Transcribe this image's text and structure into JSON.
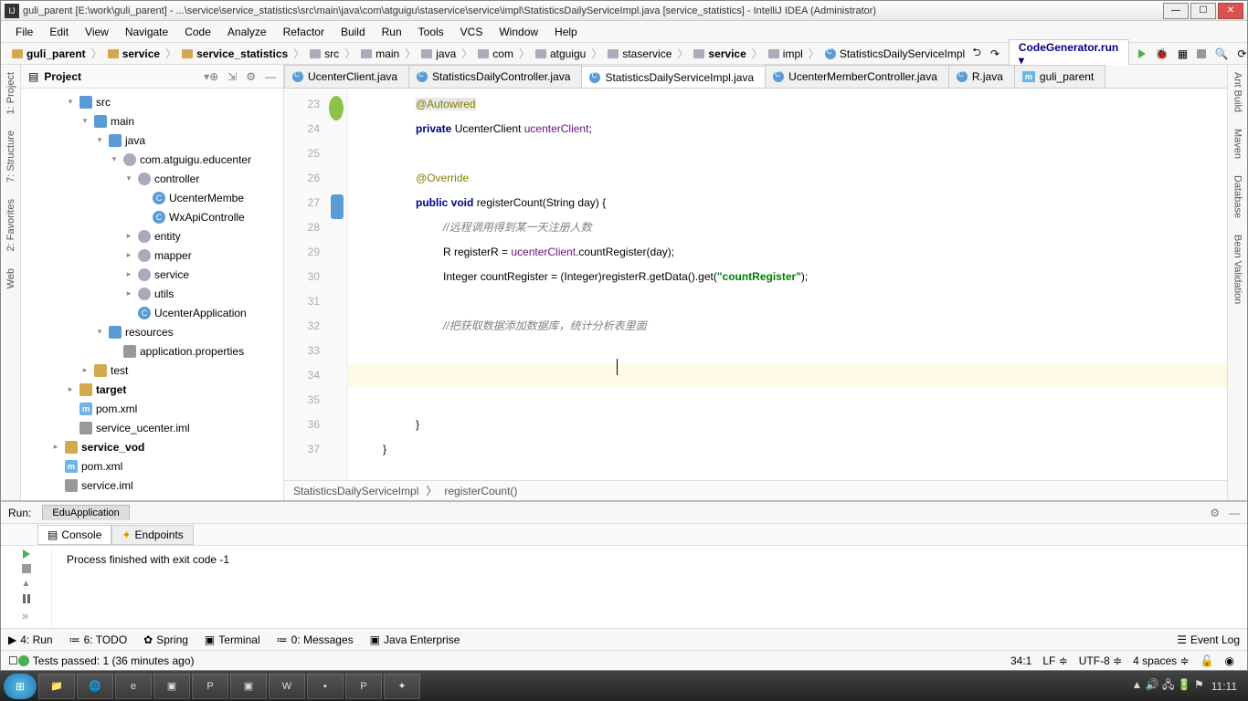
{
  "window": {
    "title": "guli_parent [E:\\work\\guli_parent] - ...\\service\\service_statistics\\src\\main\\java\\com\\atguigu\\staservice\\service\\impl\\StatisticsDailyServiceImpl.java [service_statistics] - IntelliJ IDEA (Administrator)"
  },
  "menu": [
    "File",
    "Edit",
    "View",
    "Navigate",
    "Code",
    "Analyze",
    "Refactor",
    "Build",
    "Run",
    "Tools",
    "VCS",
    "Window",
    "Help"
  ],
  "breadcrumbs": [
    "guli_parent",
    "service",
    "service_statistics",
    "src",
    "main",
    "java",
    "com",
    "atguigu",
    "staservice",
    "service",
    "impl",
    "StatisticsDailyServiceImpl"
  ],
  "run_config": "CodeGenerator.run",
  "project": {
    "title": "Project"
  },
  "tree": [
    {
      "d": 3,
      "a": "▾",
      "i": "src",
      "t": "src"
    },
    {
      "d": 4,
      "a": "▾",
      "i": "src",
      "t": "main"
    },
    {
      "d": 5,
      "a": "▾",
      "i": "src",
      "t": "java"
    },
    {
      "d": 6,
      "a": "▾",
      "i": "pkg",
      "t": "com.atguigu.educenter"
    },
    {
      "d": 7,
      "a": "▾",
      "i": "pkg",
      "t": "controller"
    },
    {
      "d": 8,
      "a": "",
      "i": "class",
      "t": "UcenterMembe"
    },
    {
      "d": 8,
      "a": "",
      "i": "class",
      "t": "WxApiControlle"
    },
    {
      "d": 7,
      "a": "▸",
      "i": "pkg",
      "t": "entity"
    },
    {
      "d": 7,
      "a": "▸",
      "i": "pkg",
      "t": "mapper"
    },
    {
      "d": 7,
      "a": "▸",
      "i": "pkg",
      "t": "service"
    },
    {
      "d": 7,
      "a": "▸",
      "i": "pkg",
      "t": "utils"
    },
    {
      "d": 7,
      "a": "",
      "i": "class",
      "t": "UcenterApplication"
    },
    {
      "d": 5,
      "a": "▾",
      "i": "src",
      "t": "resources"
    },
    {
      "d": 6,
      "a": "",
      "i": "file",
      "t": "application.properties"
    },
    {
      "d": 4,
      "a": "▸",
      "i": "folder",
      "t": "test"
    },
    {
      "d": 3,
      "a": "▸",
      "i": "folder-o",
      "t": "target",
      "b": true
    },
    {
      "d": 3,
      "a": "",
      "i": "m",
      "t": "pom.xml"
    },
    {
      "d": 3,
      "a": "",
      "i": "file",
      "t": "service_ucenter.iml"
    },
    {
      "d": 2,
      "a": "▸",
      "i": "folder",
      "t": "service_vod",
      "b": true
    },
    {
      "d": 2,
      "a": "",
      "i": "m",
      "t": "pom.xml"
    },
    {
      "d": 2,
      "a": "",
      "i": "file",
      "t": "service.iml"
    }
  ],
  "left_tabs": [
    "1: Project",
    "7: Structure",
    "2: Favorites",
    "Web"
  ],
  "right_tabs": [
    "Ant Build",
    "Maven",
    "Database",
    "Bean Validation"
  ],
  "editor_tabs": [
    {
      "label": "UcenterClient.java",
      "active": false
    },
    {
      "label": "StatisticsDailyController.java",
      "active": false
    },
    {
      "label": "StatisticsDailyServiceImpl.java",
      "active": true
    },
    {
      "label": "UcenterMemberController.java",
      "active": false
    },
    {
      "label": "R.java",
      "active": false
    },
    {
      "label": "guli_parent",
      "active": false,
      "m": true
    }
  ],
  "code": {
    "line_start": 23,
    "lines": [
      {
        "n": 23,
        "indent": 2,
        "html": "ann-bg",
        "text": "@Autowired"
      },
      {
        "n": 24,
        "indent": 2,
        "segs": [
          [
            "kw",
            "private"
          ],
          [
            "",
            " UcenterClient "
          ],
          [
            "fld",
            "ucenterClient"
          ],
          [
            "",
            ";"
          ]
        ]
      },
      {
        "n": 25,
        "indent": 0,
        "text": ""
      },
      {
        "n": 26,
        "indent": 2,
        "segs": [
          [
            "ann",
            "@Override"
          ]
        ]
      },
      {
        "n": 27,
        "indent": 2,
        "segs": [
          [
            "kw",
            "public void"
          ],
          [
            "",
            " "
          ],
          [
            "",
            "registerCount(String day) {"
          ]
        ]
      },
      {
        "n": 28,
        "indent": 3,
        "segs": [
          [
            "cmt",
            "//远程调用得到某一天注册人数"
          ]
        ]
      },
      {
        "n": 29,
        "indent": 3,
        "segs": [
          [
            "",
            "R registerR = "
          ],
          [
            "fld",
            "ucenterClient"
          ],
          [
            "",
            ".countRegister(day);"
          ]
        ]
      },
      {
        "n": 30,
        "indent": 3,
        "segs": [
          [
            "",
            "Integer "
          ],
          [
            "",
            "countRegister"
          ],
          [
            "",
            " = (Integer)registerR.getData().get("
          ],
          [
            "str",
            "\"countRegister\""
          ],
          [
            "",
            ");"
          ]
        ]
      },
      {
        "n": 31,
        "indent": 0,
        "text": ""
      },
      {
        "n": 32,
        "indent": 3,
        "segs": [
          [
            "cmt",
            "//把获取数据添加数据库，统计分析表里面"
          ]
        ]
      },
      {
        "n": 33,
        "indent": 0,
        "text": ""
      },
      {
        "n": 34,
        "indent": 0,
        "text": "",
        "current": true
      },
      {
        "n": 35,
        "indent": 0,
        "text": ""
      },
      {
        "n": 36,
        "indent": 2,
        "text": "}"
      },
      {
        "n": 37,
        "indent": 1,
        "text": "}"
      }
    ]
  },
  "code_crumbs": [
    "StatisticsDailyServiceImpl",
    "registerCount()"
  ],
  "run": {
    "label": "Run:",
    "app": "EduApplication",
    "subtabs": [
      "Console",
      "Endpoints"
    ],
    "output": "Process finished with exit code -1"
  },
  "bottom_tools": [
    "4: Run",
    "6: TODO",
    "Spring",
    "Terminal",
    "0: Messages",
    "Java Enterprise"
  ],
  "event_log": "Event Log",
  "status": {
    "msg": "Tests passed: 1 (36 minutes ago)",
    "pos": "34:1",
    "sep": "LF",
    "enc": "UTF-8",
    "tab": "4 spaces"
  },
  "clock": "11:11"
}
